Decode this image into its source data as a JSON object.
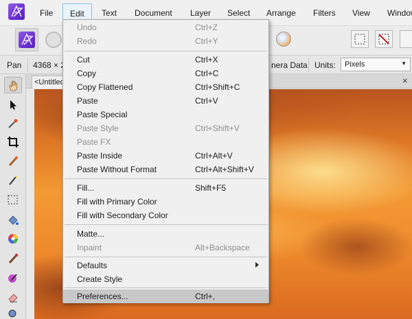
{
  "menubar": {
    "items": [
      "File",
      "Edit",
      "Text",
      "Document",
      "Layer",
      "Select",
      "Arrange",
      "Filters",
      "View",
      "Window"
    ],
    "open_item": "Edit"
  },
  "context_bar": {
    "tool_name": "Pan",
    "dimensions_fragment": "4368 × 2",
    "camera_data_fragment": "nera Data",
    "units_label": "Units:",
    "units_value": "Pixels"
  },
  "document": {
    "tab_title": "<Untitled>",
    "close_glyph": "×"
  },
  "edit_menu": {
    "items": [
      {
        "label": "Undo",
        "shortcut": "Ctrl+Z",
        "enabled": false
      },
      {
        "label": "Redo",
        "shortcut": "Ctrl+Y",
        "enabled": false
      },
      {
        "label": "Cut",
        "shortcut": "Ctrl+X",
        "enabled": true
      },
      {
        "label": "Copy",
        "shortcut": "Ctrl+C",
        "enabled": true
      },
      {
        "label": "Copy Flattened",
        "shortcut": "Ctrl+Shift+C",
        "enabled": true
      },
      {
        "label": "Paste",
        "shortcut": "Ctrl+V",
        "enabled": true
      },
      {
        "label": "Paste Special",
        "shortcut": "",
        "enabled": true
      },
      {
        "label": "Paste Style",
        "shortcut": "Ctrl+Shift+V",
        "enabled": false
      },
      {
        "label": "Paste FX",
        "shortcut": "",
        "enabled": false
      },
      {
        "label": "Paste Inside",
        "shortcut": "Ctrl+Alt+V",
        "enabled": true
      },
      {
        "label": "Paste Without Format",
        "shortcut": "Ctrl+Alt+Shift+V",
        "enabled": true
      },
      {
        "label": "Fill...",
        "shortcut": "Shift+F5",
        "enabled": true
      },
      {
        "label": "Fill with Primary Color",
        "shortcut": "",
        "enabled": true
      },
      {
        "label": "Fill with Secondary Color",
        "shortcut": "",
        "enabled": true
      },
      {
        "label": "Matte...",
        "shortcut": "",
        "enabled": true
      },
      {
        "label": "Inpaint",
        "shortcut": "Alt+Backspace",
        "enabled": false
      },
      {
        "label": "Defaults",
        "shortcut": "",
        "enabled": true,
        "submenu": true
      },
      {
        "label": "Create Style",
        "shortcut": "",
        "enabled": true
      },
      {
        "label": "Preferences...",
        "shortcut": "Ctrl+,",
        "enabled": true,
        "highlighted": true
      }
    ]
  },
  "icons": {
    "toolbox": [
      "hand-icon",
      "move-pointer-icon",
      "color-picker-icon",
      "crop-icon",
      "paint-brush-icon",
      "selection-brush-icon",
      "marquee-selection-icon",
      "flood-fill-icon",
      "color-wheel-icon",
      "pixel-brush-icon",
      "clone-brush-icon",
      "erase-brush-icon",
      "zoom-icon"
    ]
  },
  "colors": {
    "accent": "#6a2fd0",
    "menu_highlight": "#c8c8c8",
    "disabled_text": "#8e8e8e"
  }
}
